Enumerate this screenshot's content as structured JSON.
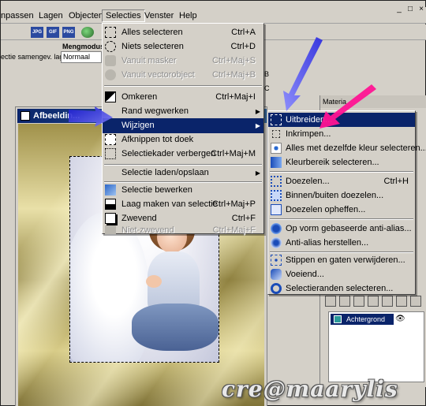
{
  "menubar": {
    "items": [
      "npassen",
      "Lagen",
      "Objecten",
      "Selecties",
      "Venster",
      "Help"
    ],
    "window_controls": [
      "_",
      "□",
      "×"
    ]
  },
  "toolbar": {
    "icons": [
      "jpeg-icon",
      "gif-icon",
      "png-icon",
      "web-icon"
    ],
    "selection_mode_label": "ectie samengev. lagen",
    "blend_mode_label": "Mengmodus:",
    "blend_mode_value": "Normaal",
    "tab_labels": [
      "B",
      "C"
    ]
  },
  "image_window": {
    "title": "Afbeeldin..."
  },
  "selecties_menu": {
    "items": [
      {
        "label": "Alles selecteren",
        "shortcut": "Ctrl+A",
        "disabled": false
      },
      {
        "label": "Niets selecteren",
        "shortcut": "Ctrl+D",
        "disabled": false
      },
      {
        "label": "Vanuit masker",
        "shortcut": "Ctrl+Maj+S",
        "disabled": true
      },
      {
        "label": "Vanuit vectorobject",
        "shortcut": "Ctrl+Maj+B",
        "disabled": true
      },
      {
        "label": "Omkeren",
        "shortcut": "Ctrl+Maj+I",
        "disabled": false
      },
      {
        "label": "Rand wegwerken",
        "shortcut": "",
        "submenu": true,
        "disabled": false
      },
      {
        "label": "Wijzigen",
        "shortcut": "",
        "submenu": true,
        "disabled": false,
        "highlighted": true
      },
      {
        "label": "Afknippen tot doek",
        "shortcut": "",
        "disabled": false
      },
      {
        "label": "Selectiekader verbergen",
        "shortcut": "Ctrl+Maj+M",
        "disabled": false
      },
      {
        "label": "Selectie laden/opslaan",
        "shortcut": "",
        "submenu": true,
        "disabled": false
      },
      {
        "label": "Selectie bewerken",
        "shortcut": "",
        "disabled": false
      },
      {
        "label": "Laag maken van selectie",
        "shortcut": "Ctrl+Maj+P",
        "disabled": false
      },
      {
        "label": "Zwevend",
        "shortcut": "Ctrl+F",
        "disabled": false
      },
      {
        "label": "Niet-zwevend",
        "shortcut": "Ctrl+Maj+F",
        "disabled": true
      }
    ]
  },
  "wijzigen_submenu": {
    "items": [
      {
        "label": "Uitbreiden...",
        "shortcut": "",
        "highlighted": true
      },
      {
        "label": "Inkrimpen...",
        "shortcut": ""
      },
      {
        "label": "Alles met dezelfde kleur selecteren...",
        "shortcut": ""
      },
      {
        "label": "Kleurbereik selecteren...",
        "shortcut": ""
      },
      {
        "label": "Doezelen...",
        "shortcut": "Ctrl+H"
      },
      {
        "label": "Binnen/buiten doezelen...",
        "shortcut": ""
      },
      {
        "label": "Doezelen opheffen...",
        "shortcut": ""
      },
      {
        "label": "Op vorm gebaseerde anti-alias...",
        "shortcut": ""
      },
      {
        "label": "Anti-alias herstellen...",
        "shortcut": ""
      },
      {
        "label": "Stippen en gaten verwijderen...",
        "shortcut": ""
      },
      {
        "label": "Voeiend...",
        "shortcut": ""
      },
      {
        "label": "Selectieranden selecteren...",
        "shortcut": ""
      }
    ]
  },
  "materials_panel": {
    "title": "Materia"
  },
  "layers_panel": {
    "layer_name": "Achtergrond"
  },
  "watermark": "cre@maarylis",
  "colors": {
    "highlight": "#0a246a",
    "menu_bg": "#d4d0c8",
    "arrow_blue": "#3a3ae0",
    "arrow_pink": "#ff1493"
  }
}
